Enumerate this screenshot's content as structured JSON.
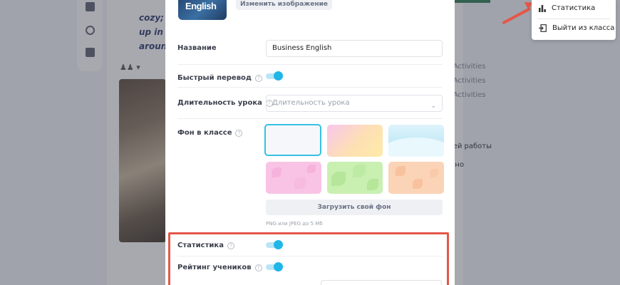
{
  "background": {
    "italic_lines": [
      "cozy; th",
      "up in a",
      "around"
    ],
    "people_icon": "users-icon",
    "right_texts": [
      "ng Activities",
      "ng Activities",
      "ng Activities",
      "шней работы",
      "ально"
    ]
  },
  "menu": {
    "items": [
      {
        "label": "Статистика",
        "icon": "bar-chart-icon"
      },
      {
        "label": "Выйти из класса",
        "icon": "exit-icon"
      }
    ]
  },
  "modal": {
    "cover_text": "English",
    "change_image_label": "Изменить изображение",
    "name_label": "Название",
    "name_value": "Business English",
    "quick_translate_label": "Быстрый перевод",
    "quick_translate_on": true,
    "lesson_duration_label": "Длительность урока",
    "lesson_duration_placeholder": "Длительность урока",
    "class_bg_label": "Фон в классе",
    "upload_bg_label": "Загрузить свой фон",
    "upload_hint": "PNG или JPEG до 5 Мб",
    "statistics_label": "Статистика",
    "statistics_on": true,
    "rating_label": "Рейтинг учеников",
    "rating_on": true,
    "help_symbol": "?"
  },
  "colors": {
    "accent": "#1fb6e8",
    "highlight": "#e4574a"
  }
}
